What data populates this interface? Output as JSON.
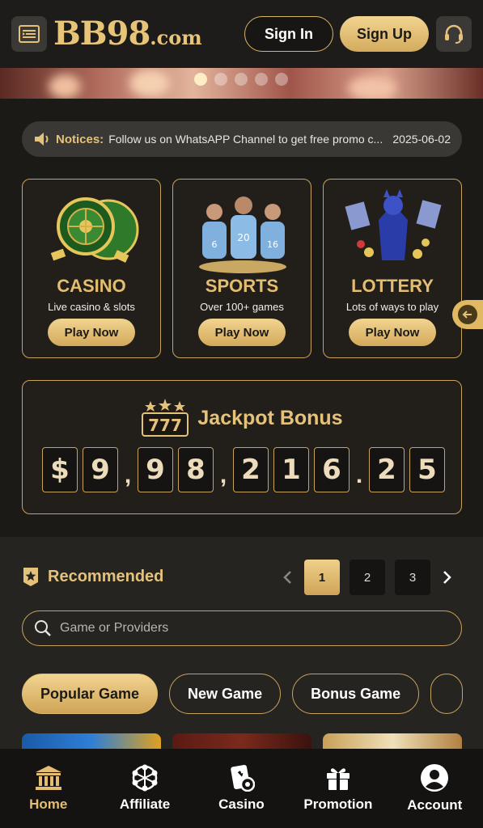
{
  "header": {
    "logo_main": "BB98",
    "logo_suffix": ".com",
    "signin_label": "Sign In",
    "signup_label": "Sign Up"
  },
  "banner": {
    "active_slide": 1,
    "slide_count": 5
  },
  "notice": {
    "label": "Notices:",
    "message": "Follow us on WhatsAPP Channel to get free promo c...",
    "date": "2025-06-02"
  },
  "categories": [
    {
      "title": "CASINO",
      "subtitle": "Live casino & slots",
      "button": "Play Now",
      "icon": "roulette-icon"
    },
    {
      "title": "SPORTS",
      "subtitle": "Over 100+ games",
      "button": "Play Now",
      "icon": "football-players-icon"
    },
    {
      "title": "LOTTERY",
      "subtitle": "Lots of ways to play",
      "button": "Play Now",
      "icon": "lottery-heroine-icon"
    }
  ],
  "jackpot": {
    "badge": "777",
    "title": "Jackpot Bonus",
    "digits": [
      "$",
      "9",
      ",",
      "9",
      "8",
      ",",
      "2",
      "1",
      "6",
      ".",
      "2",
      "5"
    ]
  },
  "recommended": {
    "title": "Recommended",
    "pages": [
      "1",
      "2",
      "3"
    ],
    "active_page": "1",
    "search_placeholder": "Game or Providers",
    "chips": [
      "Popular Game",
      "New Game",
      "Bonus Game"
    ]
  },
  "nav": {
    "items": [
      {
        "label": "Home",
        "icon": "home-bank-icon"
      },
      {
        "label": "Affiliate",
        "icon": "affiliate-network-icon"
      },
      {
        "label": "Casino",
        "icon": "casino-cards-icon"
      },
      {
        "label": "Promotion",
        "icon": "gift-icon"
      },
      {
        "label": "Account",
        "icon": "account-icon"
      }
    ]
  },
  "colors": {
    "gold": "#e5c27a",
    "background": "#1c1a17",
    "card": "#221f1b"
  }
}
